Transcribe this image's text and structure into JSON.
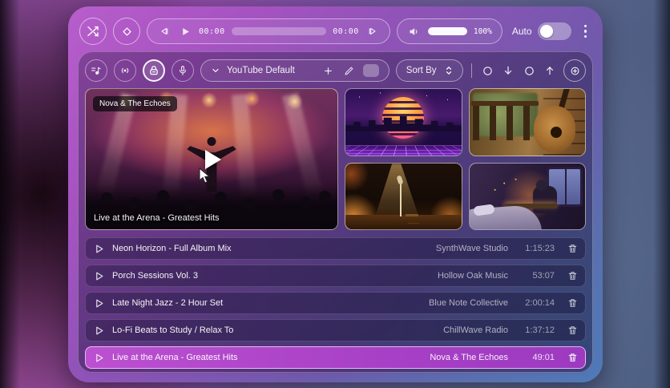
{
  "transport": {
    "current_time": "00:00",
    "total_time": "00:00",
    "volume_label": "100%",
    "auto_label": "Auto",
    "auto_enabled": false
  },
  "library_toolbar": {
    "preset_label": "YouTube Default",
    "sort_label": "Sort By"
  },
  "player": {
    "badge": "Nova & The Echoes",
    "caption": "Live at the Arena - Greatest Hits"
  },
  "thumbnails": [
    {
      "name": "synthwave-city"
    },
    {
      "name": "porch-guitar"
    },
    {
      "name": "jazz-stage"
    },
    {
      "name": "cozy-room"
    }
  ],
  "playlist": [
    {
      "title": "Neon Horizon - Full Album Mix",
      "channel": "SynthWave Studio",
      "duration": "1:15:23",
      "active": false
    },
    {
      "title": "Porch Sessions Vol. 3",
      "channel": "Hollow Oak Music",
      "duration": "53:07",
      "active": false
    },
    {
      "title": "Late Night Jazz - 2 Hour Set",
      "channel": "Blue Note Collective",
      "duration": "2:00:14",
      "active": false
    },
    {
      "title": "Lo-Fi Beats to Study / Relax To",
      "channel": "ChillWave Radio",
      "duration": "1:37:12",
      "active": false
    },
    {
      "title": "Live at the Arena - Greatest Hits",
      "channel": "Nova & The Echoes",
      "duration": "49:01",
      "active": true
    }
  ],
  "colors": {
    "accent_magenta": "#b84ecf",
    "window_gradient_start": "#b75ecb",
    "window_gradient_end": "#4f7ab8",
    "active_row": "#a840c6"
  },
  "icons": {
    "shuffle": "crossed-arrows",
    "clear": "diamond-outline",
    "prev": "skip-back",
    "play": "play-triangle",
    "next": "skip-forward",
    "volume": "speaker-waves",
    "menu": "vertical-dots",
    "tracks": "music-note-lines",
    "broadcast": "radio-waves",
    "lock": "padlock",
    "mic": "microphone",
    "chevron_down": "v",
    "add": "+",
    "edit": "pencil",
    "sort": "up-down-chevrons",
    "circle_down": "circle + down-arrow",
    "circle_up": "circle + up-arrow",
    "locate": "circled-plus",
    "row_play": "play-outline",
    "delete": "trash-can",
    "cursor": "mouse-pointer"
  }
}
